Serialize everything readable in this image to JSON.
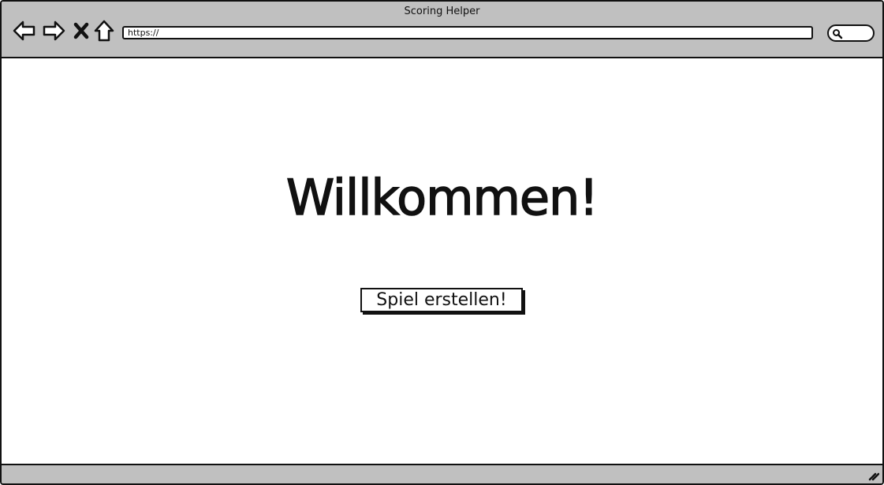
{
  "window": {
    "title": "Scoring Helper"
  },
  "toolbar": {
    "back_icon": "back-arrow-icon",
    "forward_icon": "forward-arrow-icon",
    "close_icon": "close-x-icon",
    "home_icon": "home-icon",
    "url": "https://",
    "search_icon": "magnifier-icon"
  },
  "main": {
    "heading": "Willkommen!",
    "create_game_label": "Spiel erstellen!"
  },
  "statusbar": {
    "resize_icon": "resize-grip-icon"
  },
  "colors": {
    "chrome": "#c0c0c0",
    "stroke": "#111111",
    "background": "#ffffff"
  }
}
